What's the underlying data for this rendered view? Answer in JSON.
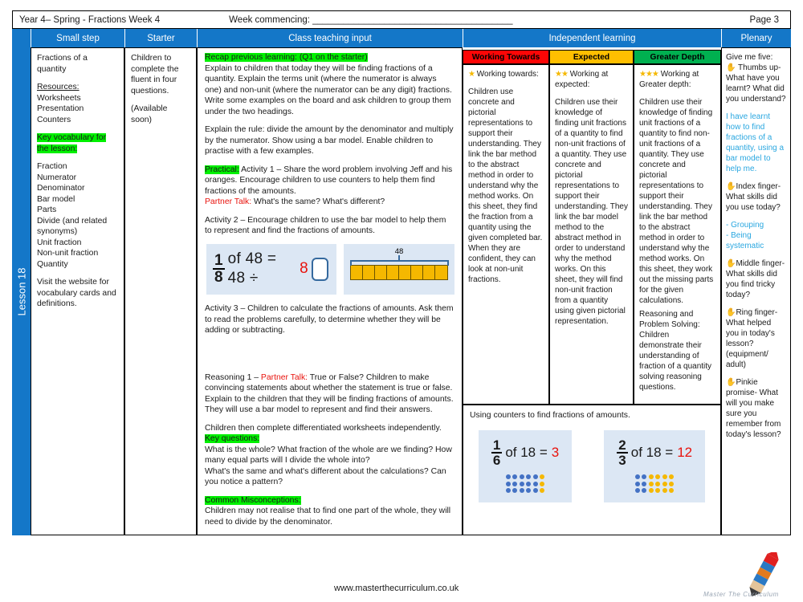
{
  "titlebar": {
    "left": "Year 4– Spring - Fractions Week 4",
    "week_commencing": "Week commencing: _______________________________________",
    "page": "Page 3"
  },
  "headers": {
    "small_step": "Small step",
    "starter": "Starter",
    "class_teaching_input": "Class teaching input",
    "independent_learning": "Independent learning",
    "plenary": "Plenary"
  },
  "spine": {
    "label": "Lesson 18"
  },
  "small_step": {
    "title": "Fractions of a quantity",
    "resources_heading": "Resources:",
    "resources": [
      "Worksheets",
      "Presentation",
      "Counters"
    ],
    "key_vocab_heading": "Key vocabulary for the lesson:",
    "vocab": [
      "Fraction",
      "Numerator",
      "Denominator",
      "Bar model",
      "Parts",
      "Divide (and  related synonyms)",
      "Unit fraction",
      "Non-unit fraction",
      "Quantity"
    ],
    "website_note": "Visit the website for vocabulary cards and definitions."
  },
  "starter": {
    "line1": "Children to complete the fluent in four questions.",
    "line2": "(Available soon)"
  },
  "class_teaching": {
    "recap_heading": "Recap previous learning: (Q1 on the starter)",
    "recap_body": "Explain to children that today they will be finding fractions of a quantity. Explain the terms unit (where the numerator is always one) and non-unit (where the numerator can be any digit) fractions. Write some examples on the board and ask children to group them under the two headings.",
    "rule_body": "Explain the rule: divide the amount by the denominator and multiply by the numerator. Show using a bar model.  Enable children to practise with a few examples.",
    "practical_label": "Practical:",
    "activity1": "Activity 1 – Share the word problem involving Jeff and his oranges. Encourage children to use counters  to help them find fractions of the amounts.",
    "partner_talk_label": "Partner Talk:",
    "partner_talk_1": "What's the same? What's different?",
    "activity2": "Activity 2 – Encourage children to use the bar model to help them to represent and find the fractions of amounts.",
    "equation": {
      "numerator": "1",
      "denominator": "8",
      "text_before": "of 48 = 48 ÷",
      "divisor": "8",
      "answer": ""
    },
    "bar_model": {
      "total_label": "48",
      "parts": 8
    },
    "activity3": "Activity 3 – Children to calculate the fractions of amounts. Ask them to read the problems carefully, to determine whether they will be adding or subtracting.",
    "reasoning_prefix": "Reasoning 1 –",
    "reasoning_body": "True or False? Children to make convincing statements about whether the statement is true or false. Explain to the children that they will be finding fractions of amounts. They will use a bar model to represent and find their answers.",
    "worksheets_line": "Children then complete differentiated worksheets independently.",
    "key_questions_heading": "Key questions:",
    "key_questions": [
      "What is the whole? What fraction of the whole are we finding? How many equal parts will I divide the whole into?",
      "What's the same and what's different about the calculations? Can you notice a pattern?"
    ],
    "misconceptions_heading": "Common Misconceptions:",
    "misconceptions_body": "Children may not realise that to find one part of the whole, they will need to divide by the denominator."
  },
  "independent": {
    "columns": [
      {
        "header": "Working Towards",
        "header_color": "#fc0606",
        "stars": "★",
        "subtitle": "Working towards:",
        "body": "Children use concrete and pictorial representations to support their understanding. They link the bar method to the abstract method in order to understand why the method works. On this sheet, they find the fraction from a quantity using the given completed bar. When they are confident, they can look at non-unit fractions."
      },
      {
        "header": "Expected",
        "header_color": "#ffbf00",
        "stars": "★★",
        "subtitle": "Working at expected:",
        "body": "Children use their knowledge of finding unit fractions of a quantity to find non-unit fractions of a quantity. They use concrete and pictorial representations to support their understanding. They link the bar model method to the abstract method in order to understand why the method works. On this sheet, they will find non-unit fraction from a quantity using given pictorial representation."
      },
      {
        "header": "Greater Depth",
        "header_color": "#00b050",
        "stars": "★★★",
        "subtitle": "Working at Greater depth:",
        "body": "Children use their knowledge of finding unit fractions of a quantity to find non-unit fractions of a quantity. They use concrete and pictorial representations to support their understanding. They link the bar method to the abstract method in order to understand why the method works. On this sheet, they work out the missing parts for the given calculations.",
        "body2": "Reasoning and Problem Solving: Children demonstrate their understanding of fraction of a quantity solving reasoning questions."
      }
    ],
    "counters_caption": "Using counters to find fractions of amounts.",
    "counters": [
      {
        "numerator": "1",
        "denominator": "6",
        "text": "of 18 =",
        "answer": "3",
        "rows": 3,
        "cols": 6,
        "yellow_cols": 1
      },
      {
        "numerator": "2",
        "denominator": "3",
        "text": "of 18 =",
        "answer": "12",
        "rows": 3,
        "cols": 6,
        "yellow_cols": 4
      }
    ]
  },
  "plenary": {
    "heading": "Give me five:",
    "items": [
      {
        "hand": "✋",
        "label": " Thumbs up-",
        "question": "What have you learnt? What did you understand?",
        "answer": "I have learnt how to find fractions of a quantity, using a bar model to help me."
      },
      {
        "hand": "✋",
        "label": "Index finger-",
        "question": "What skills did  you use today?",
        "answer": "- Grouping\n- Being systematic"
      },
      {
        "hand": "✋",
        "label": "Middle finger-",
        "question": "What skills did you find tricky today?",
        "answer": ""
      },
      {
        "hand": "✋",
        "label": "Ring finger-",
        "question": "What helped you in today's lesson? (equipment/ adult)",
        "answer": ""
      },
      {
        "hand": "✋",
        "label": "Pinkie",
        "question": "promise- What will you make sure you remember from today's lesson?",
        "answer": ""
      }
    ]
  },
  "footer": {
    "url": "www.masterthecurriculum.co.uk",
    "logo_text": "Master  The  Curriculum"
  },
  "colors": {
    "header_blue": "#1477c8",
    "highlight_green": "#00f000",
    "accent_red": "#e8120c",
    "accent_cyan": "#2aa7e0"
  }
}
